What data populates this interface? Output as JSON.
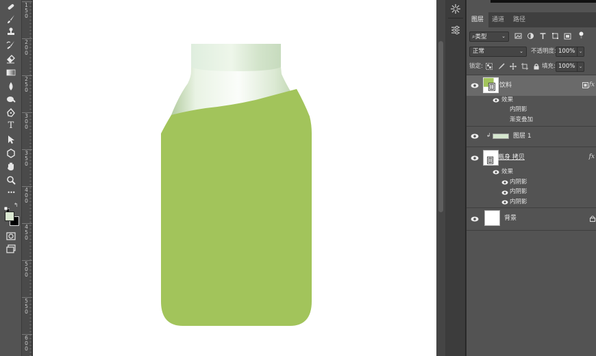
{
  "ruler": {
    "labels": [
      [
        "1",
        "5",
        "0"
      ],
      [
        "2",
        "0",
        "0"
      ],
      [
        "2",
        "5",
        "0"
      ],
      [
        "3",
        "0",
        "0"
      ],
      [
        "3",
        "5",
        "0"
      ],
      [
        "4",
        "0",
        "0"
      ],
      [
        "4",
        "5",
        "0"
      ],
      [
        "5",
        "0",
        "0"
      ],
      [
        "5",
        "5",
        "0"
      ],
      [
        "6",
        "0",
        "0"
      ]
    ]
  },
  "toolbar": {
    "tools": [
      "healing-brush-icon",
      "brush-icon",
      "clone-stamp-icon",
      "history-brush-icon",
      "eraser-icon",
      "gradient-icon",
      "blur-icon",
      "dodge-icon",
      "pen-icon",
      "type-tool",
      "path-selection-icon",
      "shape-icon",
      "hand-icon",
      "zoom-icon",
      "more-tools-icon"
    ],
    "type_glyph": "T",
    "more_glyph": "•••",
    "foreground_color": "#dbe8d2",
    "background_color": "#000000"
  },
  "canvas": {
    "background": "#ffffff",
    "liquid_color": "#a2c45b",
    "cap_color": "#d6e7cf"
  },
  "panel": {
    "tabs": [
      "图层",
      "通道",
      "路径"
    ],
    "active_tab": 0,
    "filter_label": "类型",
    "blend_mode": "正常",
    "opacity_label": "不透明度:",
    "opacity_value": "100%",
    "lock_label": "锁定:",
    "fill_label": "填充:",
    "fill_value": "100%"
  },
  "layers": [
    {
      "name": "饮料",
      "selected": true,
      "fx": "fx",
      "effects_label": "效果",
      "effects": [
        "内阴影",
        "渐变叠加"
      ]
    },
    {
      "name": "图层 1",
      "clipped": true
    },
    {
      "name": "瓶身 拷贝",
      "fx": "fx",
      "effects_label": "效果",
      "effects": [
        "内阴影",
        "内阴影",
        "内阴影"
      ]
    },
    {
      "name": "背景",
      "locked": true
    }
  ]
}
